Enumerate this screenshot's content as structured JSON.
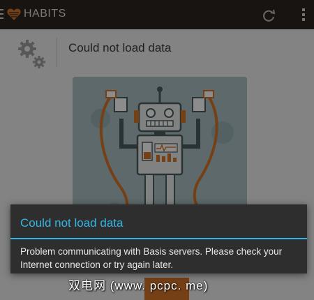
{
  "app": {
    "title": "HABITS",
    "brand_color": "#d8752a",
    "icons": {
      "back": "back-arrow-icon",
      "logo": "heart-logo-icon",
      "refresh": "refresh-icon",
      "overflow": "overflow-menu-icon",
      "status": "gears-icon"
    }
  },
  "content": {
    "error_message": "Could not load data",
    "illustration": "robot-illustration"
  },
  "dialog": {
    "title": "Could not load data",
    "message": "Problem communicating with Basis servers. Please check your Internet connection or try again later.",
    "accent_color": "#33b5e5"
  },
  "watermark": {
    "text": "双电网 (www. pcpc. me)"
  }
}
